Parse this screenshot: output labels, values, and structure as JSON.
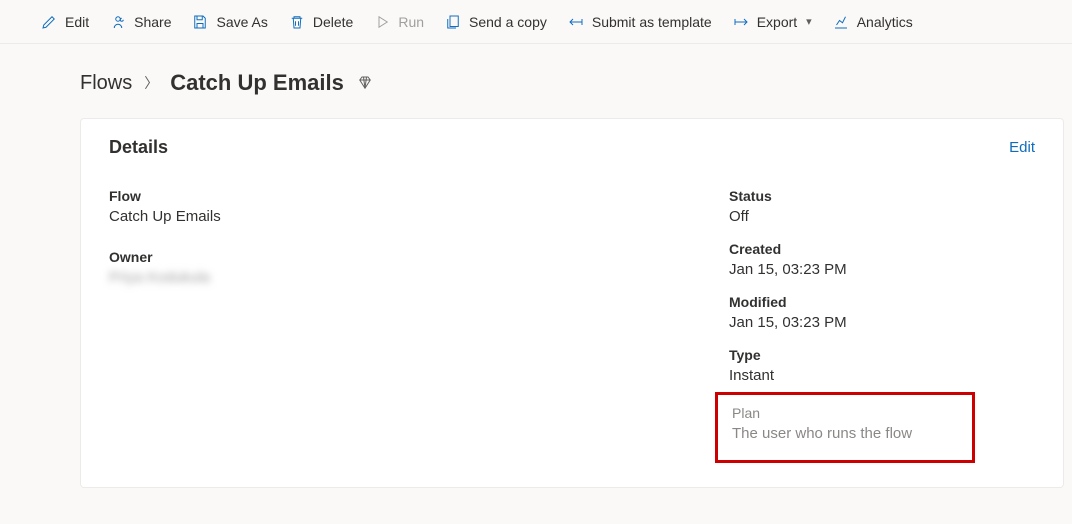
{
  "toolbar": {
    "edit": "Edit",
    "share": "Share",
    "save_as": "Save As",
    "delete": "Delete",
    "run": "Run",
    "send_copy": "Send a copy",
    "submit_template": "Submit as template",
    "export": "Export",
    "analytics": "Analytics"
  },
  "breadcrumb": {
    "root": "Flows",
    "current": "Catch Up Emails"
  },
  "details": {
    "title": "Details",
    "edit": "Edit",
    "flow_label": "Flow",
    "flow_value": "Catch Up Emails",
    "owner_label": "Owner",
    "owner_value": "Priya Kodukula",
    "status_label": "Status",
    "status_value": "Off",
    "created_label": "Created",
    "created_value": "Jan 15, 03:23 PM",
    "modified_label": "Modified",
    "modified_value": "Jan 15, 03:23 PM",
    "type_label": "Type",
    "type_value": "Instant",
    "plan_label": "Plan",
    "plan_value": "The user who runs the flow"
  }
}
